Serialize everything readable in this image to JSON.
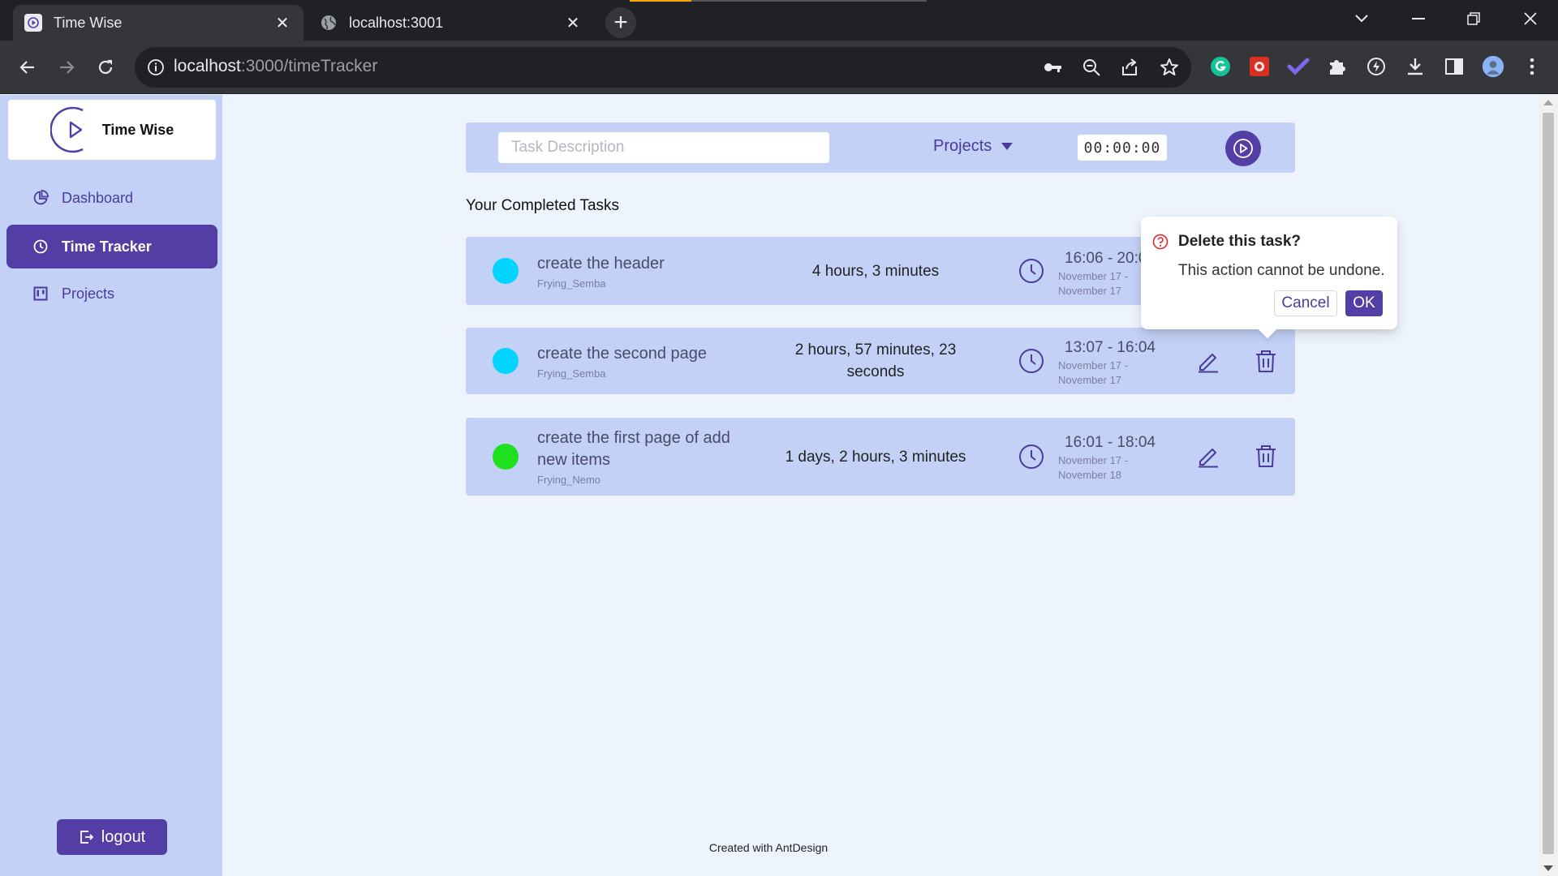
{
  "browser": {
    "tabs": [
      {
        "title": "Time Wise",
        "active": true,
        "icon": "timewise-favicon-icon"
      },
      {
        "title": "localhost:3001",
        "active": false,
        "icon": "globe-icon"
      }
    ],
    "new_tab_label": "+",
    "url_host": "localhost",
    "url_rest": ":3000/timeTracker"
  },
  "app": {
    "name": "Time Wise",
    "colors": {
      "primary": "#523ea5",
      "surface": "#c3d1f7",
      "background": "#eef4fd",
      "cyan": "#00d4ff",
      "green": "#1ee01e"
    },
    "nav": [
      {
        "label": "Dashboard",
        "icon": "pie-chart-icon",
        "active": false
      },
      {
        "label": "Time Tracker",
        "icon": "clock-icon",
        "active": true
      },
      {
        "label": "Projects",
        "icon": "project-board-icon",
        "active": false
      }
    ],
    "logout_label": "logout"
  },
  "tracker": {
    "task_placeholder": "Task Description",
    "projects_label": "Projects",
    "timer": "00:00:00"
  },
  "completed": {
    "heading": "Your Completed Tasks",
    "tasks": [
      {
        "name": "create the header",
        "project": "Frying_Semba",
        "duration": "4 hours, 3 minutes",
        "time_range": "16:06 - 20:09",
        "date_start": "November 17 -",
        "date_end": "November 17",
        "color": "#00d4ff"
      },
      {
        "name": "create the second page",
        "project": "Frying_Semba",
        "duration": "2 hours, 57 minutes, 23 seconds",
        "time_range": "13:07 - 16:04",
        "date_start": "November 17 -",
        "date_end": "November 17",
        "color": "#00d4ff"
      },
      {
        "name": "create the first page of add new items",
        "project": "Frying_Nemo",
        "duration": "1 days, 2 hours, 3 minutes",
        "time_range": "16:01 - 18:04",
        "date_start": "November 17 -",
        "date_end": "November 18",
        "color": "#1ee01e"
      }
    ]
  },
  "popconfirm": {
    "title": "Delete this task?",
    "description": "This action cannot be undone.",
    "cancel_label": "Cancel",
    "ok_label": "OK"
  },
  "footer": {
    "text": "Created with AntDesign"
  }
}
